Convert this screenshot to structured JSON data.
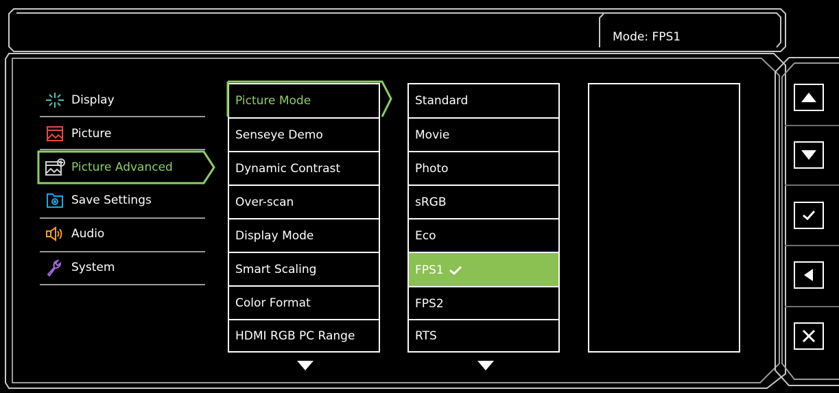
{
  "header": {
    "mode_label": "Mode: FPS1"
  },
  "main_menu": [
    {
      "label": "Display",
      "icon": "display-icon",
      "selected": false
    },
    {
      "label": "Picture",
      "icon": "picture-icon",
      "selected": false
    },
    {
      "label": "Picture Advanced",
      "icon": "picture-advanced-icon",
      "selected": true
    },
    {
      "label": "Save Settings",
      "icon": "save-settings-icon",
      "selected": false
    },
    {
      "label": "Audio",
      "icon": "audio-icon",
      "selected": false
    },
    {
      "label": "System",
      "icon": "system-icon",
      "selected": false
    }
  ],
  "submenu": [
    {
      "label": "Picture Mode",
      "selected": true
    },
    {
      "label": "Senseye Demo"
    },
    {
      "label": "Dynamic Contrast"
    },
    {
      "label": "Over-scan"
    },
    {
      "label": "Display Mode"
    },
    {
      "label": "Smart Scaling"
    },
    {
      "label": "Color Format"
    },
    {
      "label": "HDMI RGB PC Range"
    }
  ],
  "options": [
    {
      "label": "Standard"
    },
    {
      "label": "Movie"
    },
    {
      "label": "Photo"
    },
    {
      "label": "sRGB"
    },
    {
      "label": "Eco"
    },
    {
      "label": "FPS1",
      "highlighted": true,
      "checked": true
    },
    {
      "label": "FPS2"
    },
    {
      "label": "RTS"
    }
  ],
  "side_buttons": [
    "up-arrow-icon",
    "down-arrow-icon",
    "checkmark-icon",
    "left-arrow-icon",
    "close-icon"
  ],
  "colors": {
    "accent": "#8dcf63",
    "highlight": "#8bc053",
    "frame": "#bfbfbf"
  }
}
